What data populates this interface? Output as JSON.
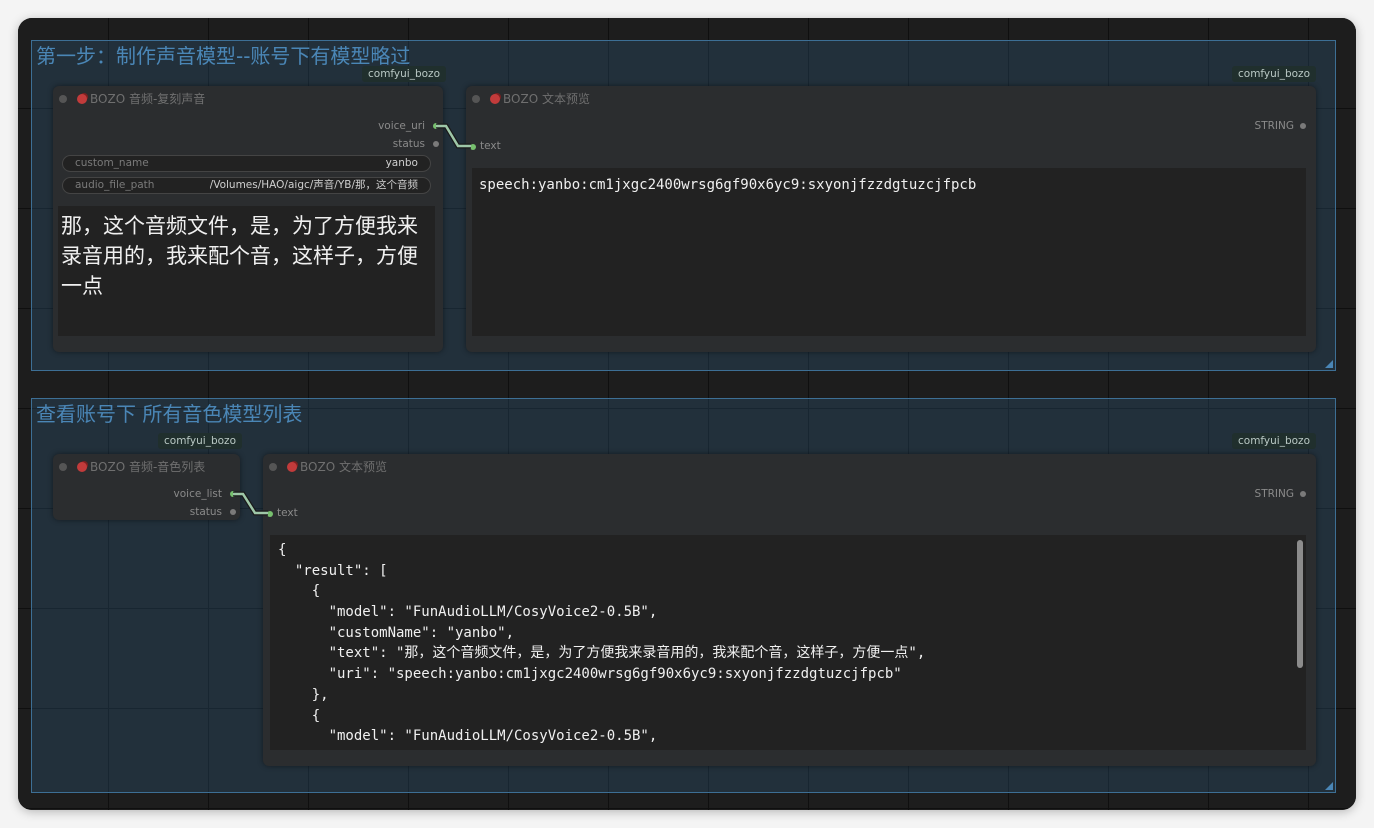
{
  "groups": {
    "step1": {
      "title": "第一步：制作声音模型--账号下有模型略过"
    },
    "step2": {
      "title": "查看账号下 所有音色模型列表"
    }
  },
  "badges": {
    "comfyui": "comfyui_bozo"
  },
  "clone_node": {
    "title": "BOZO 音频-复刻声音",
    "outputs": [
      "voice_uri",
      "status"
    ],
    "custom_name": {
      "label": "custom_name",
      "value": "yanbo"
    },
    "audio_file_path": {
      "label": "audio_file_path",
      "value": "/Volumes/HAO/aigc/声音/YB/那，这个音频"
    },
    "text": "那，这个音频文件，是，为了方便我来录音用的，我来配个音，这样子，方便一点"
  },
  "preview_node_1": {
    "title": "BOZO 文本预览",
    "input": "text",
    "output": "STRING",
    "text": "speech:yanbo:cm1jxgc2400wrsg6gf90x6yc9:sxyonjfzzdgtuzcjfpcb"
  },
  "voice_list_node": {
    "title": "BOZO 音频-音色列表",
    "outputs": [
      "voice_list",
      "status"
    ]
  },
  "preview_node_2": {
    "title": "BOZO 文本预览",
    "input": "text",
    "output": "STRING",
    "lines": [
      "{",
      "  \"result\": [",
      "    {",
      "      \"model\": \"FunAudioLLM/CosyVoice2-0.5B\",",
      "      \"customName\": \"yanbo\",",
      "      \"text\": \"那，这个音频文件，是，为了方便我来录音用的，我来配个音，这样子，方便一点\",",
      "      \"uri\": \"speech:yanbo:cm1jxgc2400wrsg6gf90x6yc9:sxyonjfzzdgtuzcjfpcb\"",
      "    },",
      "    {",
      "      \"model\": \"FunAudioLLM/CosyVoice2-0.5B\","
    ]
  },
  "colors": {
    "group_title": "#4a86b6",
    "link": "#9ec7a8",
    "slot_green": "#77c06e"
  }
}
